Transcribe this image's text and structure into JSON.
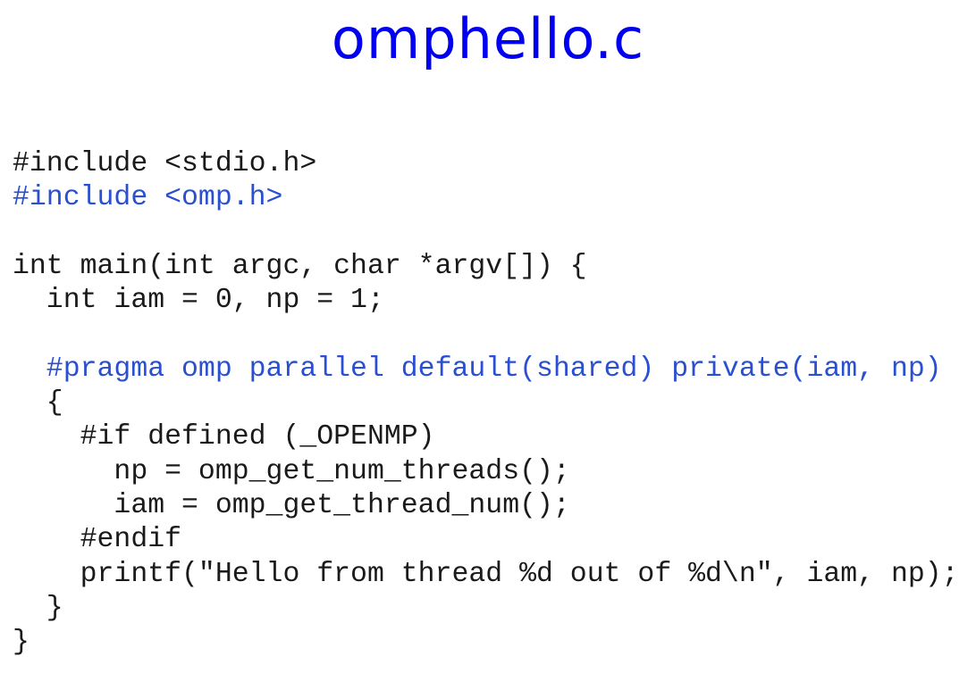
{
  "title": "omphello.c",
  "code_lines": [
    {
      "text": "#include <stdio.h>",
      "highlight": false
    },
    {
      "text": "#include <omp.h>",
      "highlight": true
    },
    {
      "text": "",
      "highlight": false
    },
    {
      "text": "int main(int argc, char *argv[]) {",
      "highlight": false
    },
    {
      "text": "  int iam = 0, np = 1;",
      "highlight": false
    },
    {
      "text": "",
      "highlight": false
    },
    {
      "text": "  #pragma omp parallel default(shared) private(iam, np)",
      "highlight": true
    },
    {
      "text": "  {",
      "highlight": false
    },
    {
      "text": "    #if defined (_OPENMP)",
      "highlight": false
    },
    {
      "text": "      np = omp_get_num_threads();",
      "highlight": false
    },
    {
      "text": "      iam = omp_get_thread_num();",
      "highlight": false
    },
    {
      "text": "    #endif",
      "highlight": false
    },
    {
      "text": "    printf(\"Hello from thread %d out of %d\\n\", iam, np);",
      "highlight": false
    },
    {
      "text": "  }",
      "highlight": false
    },
    {
      "text": "}",
      "highlight": false
    }
  ],
  "colors": {
    "title": "#0000ee",
    "code_default": "#1a1a1a",
    "code_highlight": "#2a4fd0"
  }
}
